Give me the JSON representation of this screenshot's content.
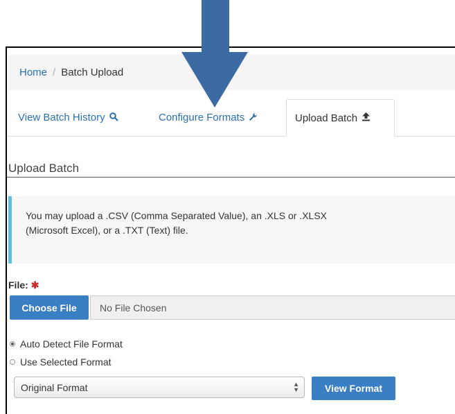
{
  "breadcrumb": {
    "home": "Home",
    "separator": "/",
    "current": "Batch Upload"
  },
  "tabs": [
    {
      "label": "View Batch History",
      "icon": "search-icon",
      "glyph": "🔍"
    },
    {
      "label": "Configure Formats",
      "icon": "wrench-icon",
      "glyph": "🔧"
    },
    {
      "label": "Upload Batch",
      "icon": "upload-icon",
      "glyph": "⭱"
    }
  ],
  "section": {
    "title": "Upload Batch"
  },
  "info": {
    "line1": "You may upload a .CSV (Comma Separated Value), an .XLS or .XLSX",
    "line2": "(Microsoft Excel), or a .TXT (Text) file."
  },
  "file": {
    "label": "File:",
    "required_mark": "✱",
    "choose_label": "Choose File",
    "status": "No File Chosen"
  },
  "format_options": [
    {
      "label": "Auto Detect File Format",
      "selected": true
    },
    {
      "label": "Use Selected Format",
      "selected": false
    }
  ],
  "format_select": {
    "value": "Original Format"
  },
  "view_format_label": "View Format",
  "colors": {
    "accent": "#3a7fc4",
    "link": "#2a6fb0",
    "info_border": "#5bc0de",
    "arrow": "#3b6ba2",
    "required": "#c9302c"
  }
}
